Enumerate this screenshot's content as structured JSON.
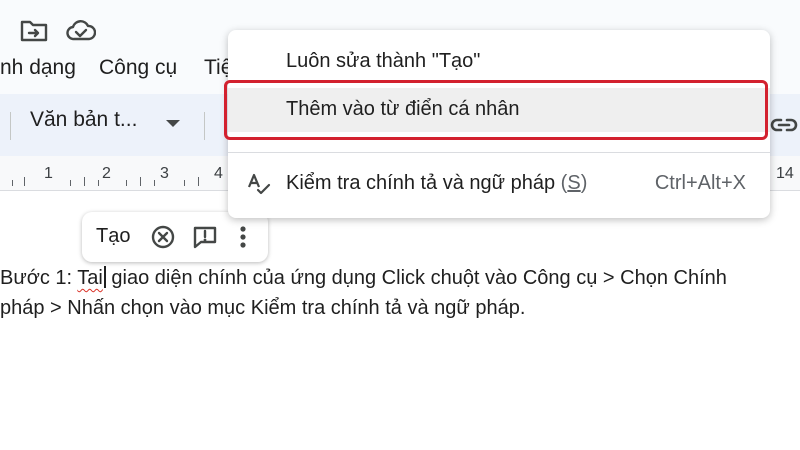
{
  "menubar": {
    "items": [
      {
        "label": "nh dạng"
      },
      {
        "label": "Công cụ"
      },
      {
        "label": "Tiệ"
      }
    ]
  },
  "toolbar": {
    "style_select": "Văn bản t..."
  },
  "ruler": {
    "numbers": [
      "1",
      "2",
      "3",
      "4",
      "14"
    ]
  },
  "document": {
    "line1_before": "Bước 1: ",
    "line1_misspelled": "Tai",
    "line1_after": " giao diện chính của ứng dụng Click chuột vào Công cụ > Chọn Chính",
    "line2": "pháp > Nhấn chọn vào mục Kiểm tra chính tả và ngữ pháp."
  },
  "suggestion_chip": {
    "word": "Tạo"
  },
  "context_menu": {
    "items": [
      {
        "label": "Luôn sửa thành \"Tạo\""
      },
      {
        "label": "Thêm vào từ điển cá nhân"
      },
      {
        "label_pre": "Kiểm tra chính tả và ngữ pháp ",
        "label_paren_open": "(",
        "label_key": "S",
        "label_paren_close": ")",
        "shortcut": "Ctrl+Alt+X"
      }
    ]
  },
  "colors": {
    "accent_highlight": "#d3212f",
    "toolbar_bg": "#edf2fa",
    "menu_hover": "#efefef"
  },
  "icons": [
    "move-to-folder-icon",
    "cloud-saved-icon",
    "link-icon",
    "dismiss-icon",
    "comment-icon",
    "more-vert-icon",
    "spellcheck-icon"
  ]
}
